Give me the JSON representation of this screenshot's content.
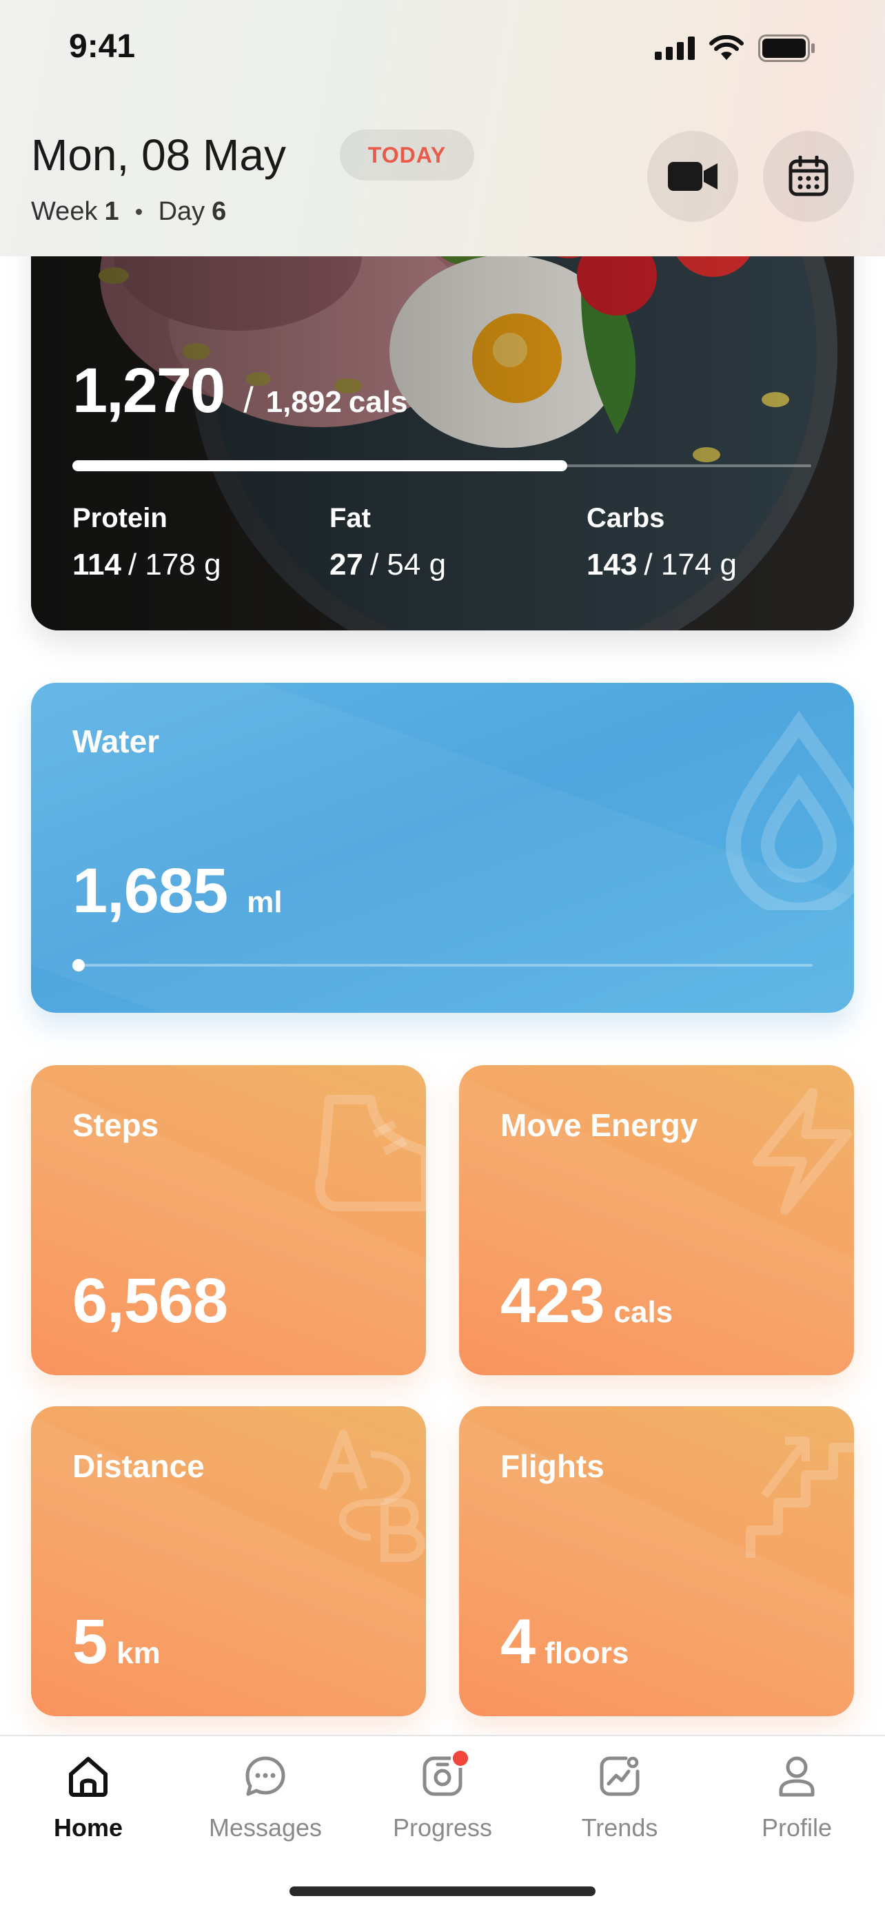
{
  "status_bar": {
    "time": "9:41"
  },
  "header": {
    "date": "Mon, 08 May",
    "today_badge": "TODAY",
    "week_label": "Week",
    "week_number": "1",
    "day_label": "Day",
    "day_number": "6",
    "video_button_icon": "video-camera-icon",
    "calendar_button_icon": "calendar-icon"
  },
  "nutrition": {
    "calories_consumed": "1,270",
    "calories_separator": "/",
    "calories_goal": "1,892",
    "calories_unit": "cals",
    "progress_fraction": 0.67,
    "macros": [
      {
        "label": "Protein",
        "current": "114",
        "goal": "/ 178 g"
      },
      {
        "label": "Fat",
        "current": "27",
        "goal": "/ 54 g"
      },
      {
        "label": "Carbs",
        "current": "143",
        "goal": "/ 174 g"
      }
    ]
  },
  "water": {
    "title": "Water",
    "value": "1,685",
    "unit": "ml",
    "icon": "water-drop-icon"
  },
  "stats": [
    {
      "title": "Steps",
      "value": "6,568",
      "unit": "",
      "icon": "shoe-icon"
    },
    {
      "title": "Move Energy",
      "value": "423",
      "unit": "cals",
      "icon": "lightning-icon"
    },
    {
      "title": "Distance",
      "value": "5",
      "unit": "km",
      "icon": "a-to-b-icon"
    },
    {
      "title": "Flights",
      "value": "4",
      "unit": "floors",
      "icon": "stairs-icon"
    }
  ],
  "tabs": [
    {
      "label": "Home",
      "icon": "home-icon",
      "active": true
    },
    {
      "label": "Messages",
      "icon": "chat-icon",
      "active": false
    },
    {
      "label": "Progress",
      "icon": "camera-icon",
      "active": false,
      "badge": true
    },
    {
      "label": "Trends",
      "icon": "trends-icon",
      "active": false
    },
    {
      "label": "Profile",
      "icon": "person-icon",
      "active": false
    }
  ],
  "colors": {
    "accent_red": "#e85b4a",
    "water_blue": "#4fa6de",
    "stat_orange": "#f6a565",
    "badge_red": "#f0463c"
  }
}
